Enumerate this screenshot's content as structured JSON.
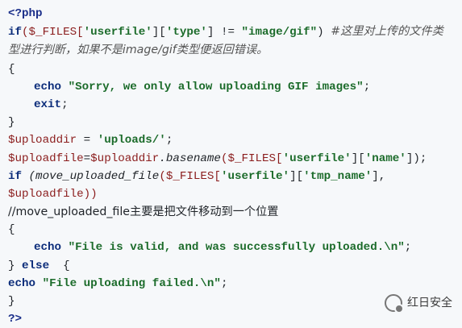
{
  "code": {
    "lines": {
      "l1_tag": "<?php",
      "l2_kw": "if",
      "l2_a": "($_FILES[",
      "l2_s1": "'userfile'",
      "l2_b": "][",
      "l2_s2": "'type'",
      "l2_c": "] != ",
      "l2_s3": "\"image/gif\"",
      "l2_d": ") ",
      "l2_comment": "#这里对上传的文件类型进行判断，如果不是image/gif类型便返回错误。",
      "l3": "{",
      "l4_kw": "echo",
      "l4_str": "\"Sorry, we only allow uploading GIF images\"",
      "l4_end": ";",
      "l5_kw": "exit",
      "l5_end": ";",
      "l6": "}",
      "l7_var": "$uploaddir",
      "l7_op": " = ",
      "l7_str": "'uploads/'",
      "l7_end": ";",
      "l8_var1": "$uploadfile",
      "l8_op": "=",
      "l8_var2": "$uploaddir",
      "l8_fn": ".basename",
      "l8_a": "($_FILES[",
      "l8_s1": "'userfile'",
      "l8_b": "][",
      "l8_s2": "'name'",
      "l8_end": "]);",
      "l9_kw": "if",
      "l9_fn": " (move_uploaded_file",
      "l9_a": "($_FILES[",
      "l9_s1": "'userfile'",
      "l9_b": "][",
      "l9_s2": "'tmp_name'",
      "l9_end": "],",
      "l10_var": "$uploadfile",
      "l10_end": "))",
      "l11": "//move_uploaded_file主要是把文件移动到一个位置",
      "l12": "{",
      "l13_kw": "echo",
      "l13_str": "\"File is valid, and was successfully uploaded.\\n\"",
      "l13_end": ";",
      "l14_a": "} ",
      "l14_kw": "else",
      "l14_b": "  {",
      "l15_kw": "echo",
      "l15_str": "\"File uploading failed.\\n\"",
      "l15_end": ";",
      "l16": "}",
      "l17_tag": "?>"
    }
  },
  "watermark": {
    "icon": "wechat-icon",
    "text": "红日安全"
  }
}
